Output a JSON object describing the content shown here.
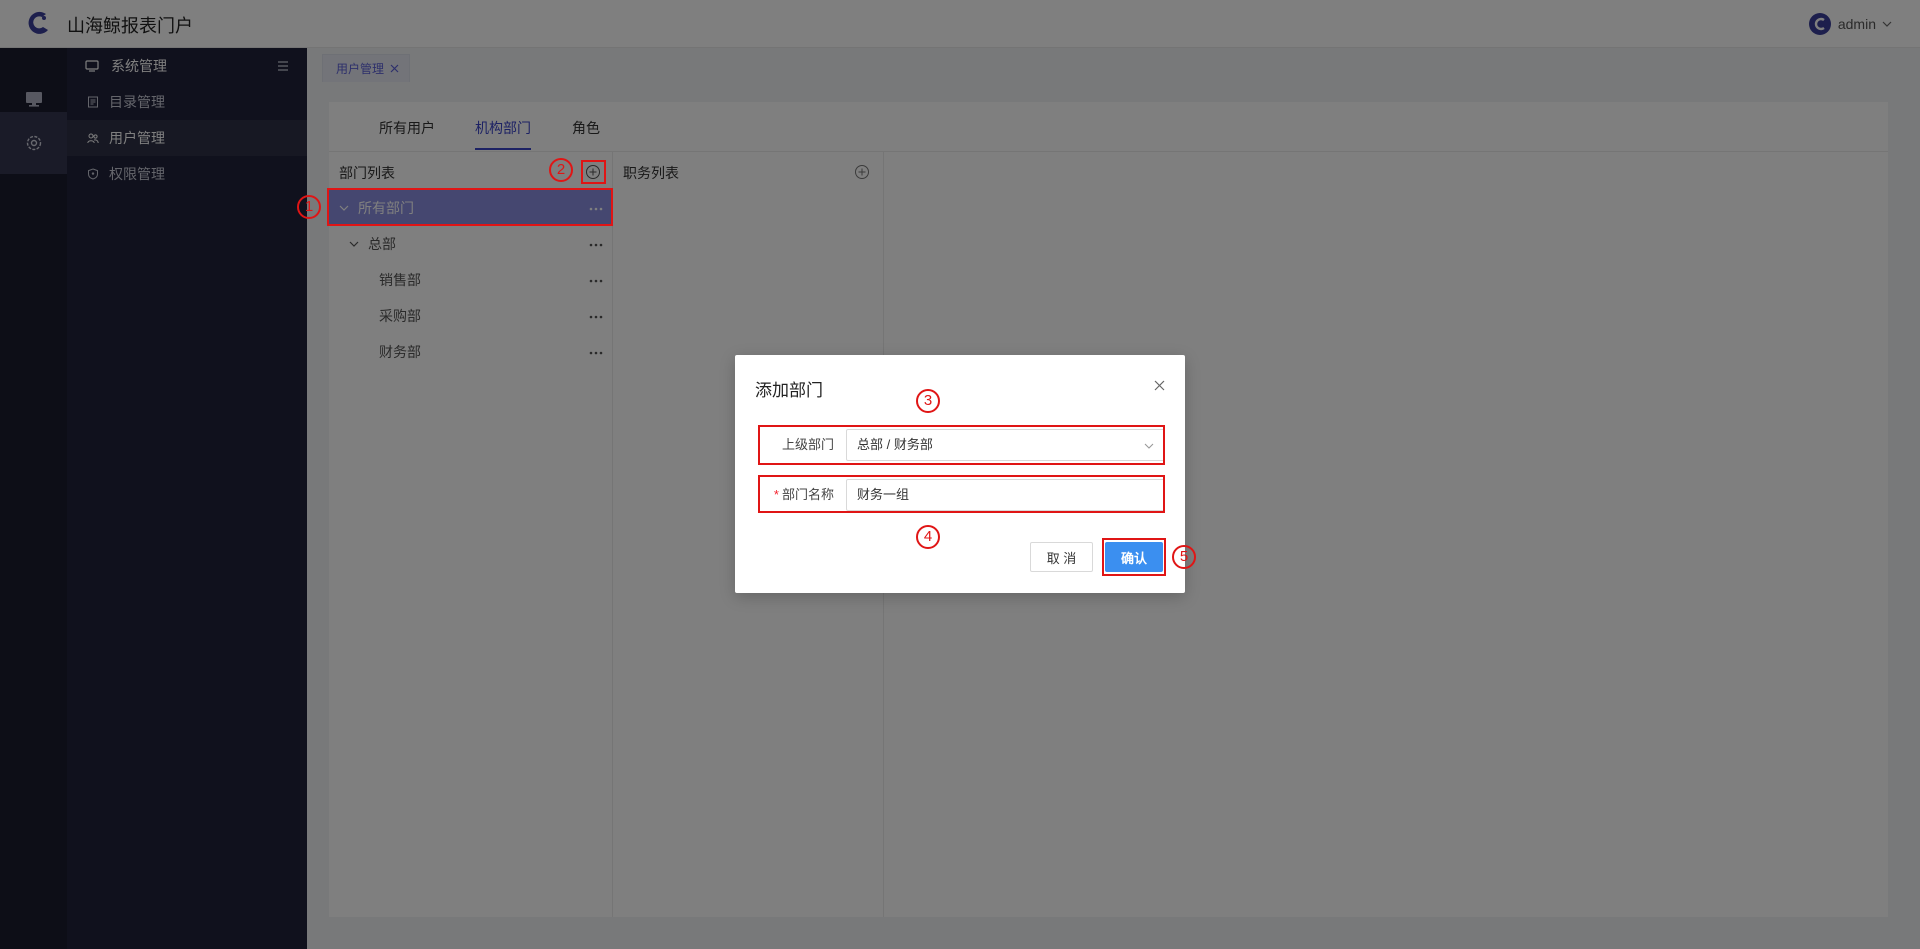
{
  "header": {
    "app_title": "山海鲸报表门户",
    "username": "admin"
  },
  "rail": {
    "items": [
      "monitor",
      "settings"
    ]
  },
  "subnav": {
    "section_title": "系统管理",
    "items": [
      {
        "label": "目录管理",
        "icon": "document-icon"
      },
      {
        "label": "用户管理",
        "icon": "users-icon"
      },
      {
        "label": "权限管理",
        "icon": "shield-icon"
      }
    ]
  },
  "tabbar": {
    "page_tab": "用户管理"
  },
  "main": {
    "tabs": [
      "所有用户",
      "机构部门",
      "角色"
    ],
    "active_tab": "机构部门",
    "dept_panel": {
      "title": "部门列表",
      "tree": [
        {
          "label": "所有部门",
          "expanded": true,
          "selected": true
        },
        {
          "label": "总部",
          "expanded": true
        },
        {
          "label": "销售部"
        },
        {
          "label": "采购部"
        },
        {
          "label": "财务部"
        }
      ]
    },
    "duty_panel": {
      "title": "职务列表"
    }
  },
  "modal": {
    "title": "添加部门",
    "parent_label": "上级部门",
    "parent_value": "总部 / 财务部",
    "name_required_mark": "*",
    "name_label": "部门名称",
    "name_value": "财务一组",
    "cancel_label": "取 消",
    "confirm_label": "确认"
  },
  "annotations": [
    "1",
    "2",
    "3",
    "4",
    "5"
  ],
  "colors": {
    "accent": "#3b44c8",
    "confirm": "#3b8ff0",
    "marker": "#e01515",
    "sidebar": "#21233a"
  }
}
